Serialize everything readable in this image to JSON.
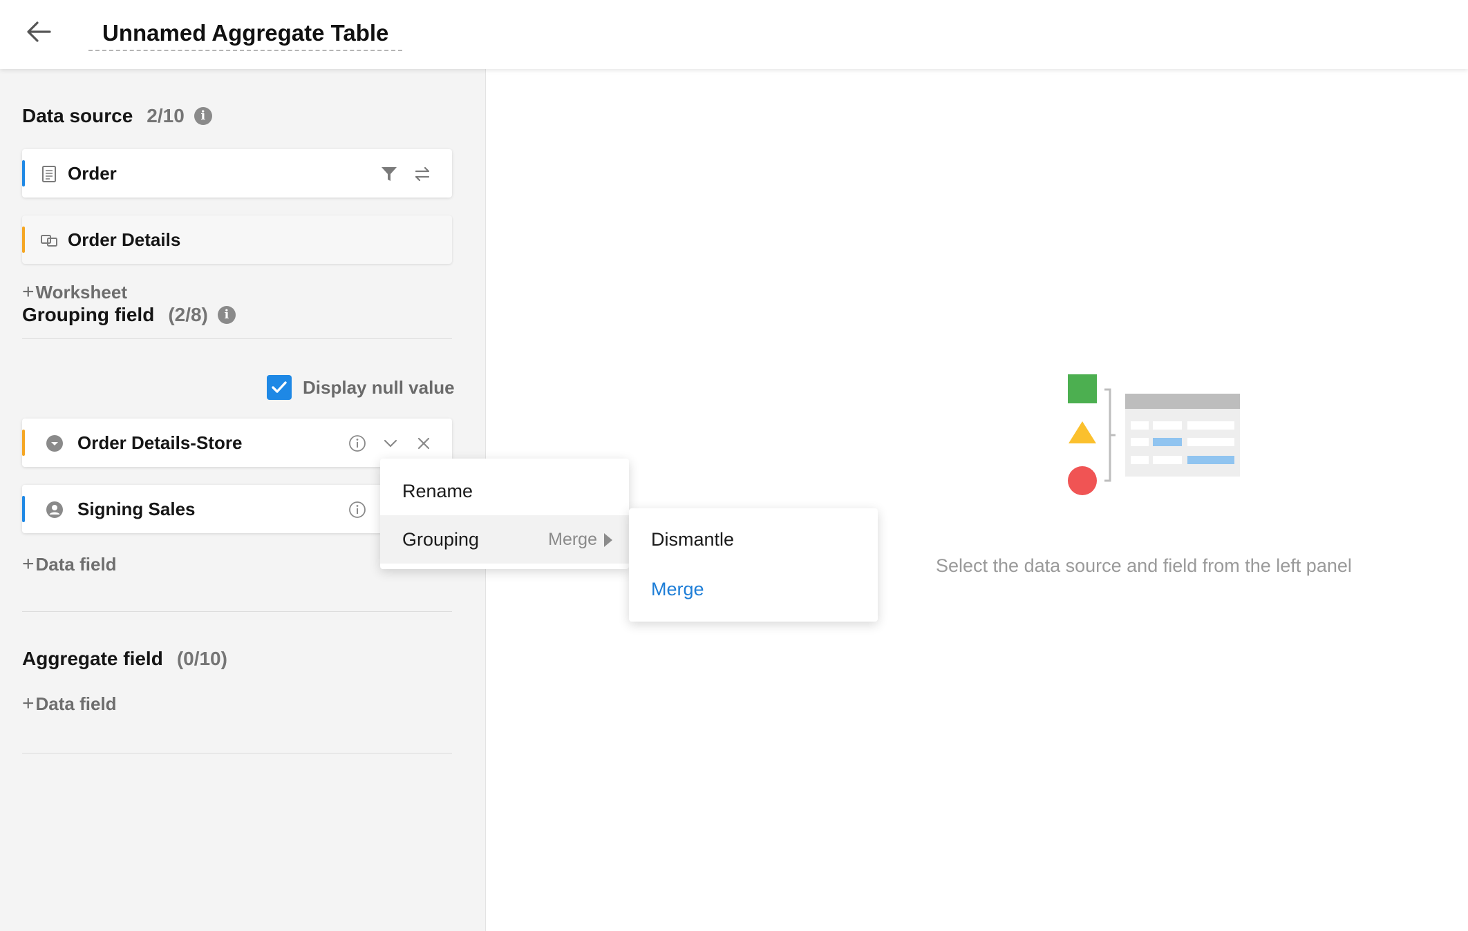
{
  "header": {
    "title": "Unnamed Aggregate Table",
    "back_icon": "arrow-left-icon"
  },
  "data_source": {
    "title": "Data source",
    "count": "2/10",
    "items": [
      {
        "label": "Order",
        "accent": "#1e88e5",
        "icon": "table-icon"
      },
      {
        "label": "Order Details",
        "accent": "#f5a623",
        "icon": "linked-table-icon"
      }
    ],
    "add_label": "Worksheet"
  },
  "grouping": {
    "title": "Grouping field",
    "count": "(2/8)",
    "display_null_label": "Display null value",
    "display_null_checked": true,
    "items": [
      {
        "label": "Order Details-Store",
        "accent": "#f5a623",
        "icon": "dropdown-circle-icon"
      },
      {
        "label": "Signing Sales",
        "accent": "#1e88e5",
        "icon": "user-circle-icon"
      }
    ],
    "add_label": "Data field"
  },
  "aggregate": {
    "title": "Aggregate field",
    "count": "(0/10)",
    "add_label": "Data field"
  },
  "context_menu": {
    "items": [
      {
        "label": "Rename"
      },
      {
        "label": "Grouping",
        "hint": "Merge"
      }
    ]
  },
  "submenu": {
    "items": [
      {
        "label": "Dismantle"
      },
      {
        "label": "Merge",
        "selected": true
      }
    ]
  },
  "empty_state": {
    "text": "Select the data source and field from the left panel"
  },
  "colors": {
    "accent_blue": "#1e88e5",
    "accent_orange": "#f5a623",
    "shape_green": "#4caf50",
    "shape_yellow": "#fbc02d",
    "shape_red": "#f05454"
  }
}
